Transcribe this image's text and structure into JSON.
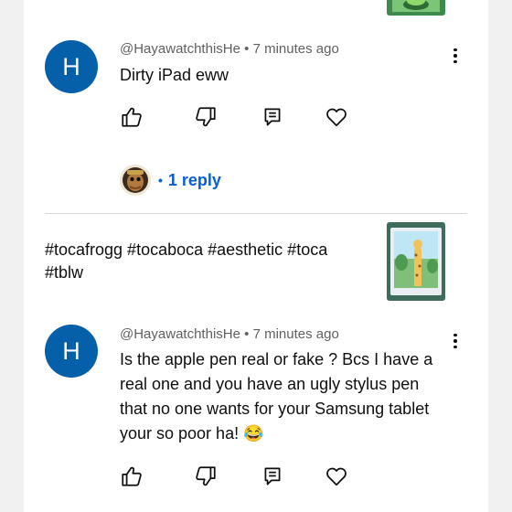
{
  "comments": [
    {
      "avatar_letter": "H",
      "author": "@HayawatchthisHe",
      "time": "7 minutes ago",
      "text": "Dirty iPad eww",
      "replies_label": "1 reply"
    },
    {
      "avatar_letter": "H",
      "author": "@HayawatchthisHe",
      "time": "7 minutes ago",
      "text": "Is the apple pen real or fake ? Bcs I have a real one and you have an ugly stylus pen that no one wants for your Samsung tablet your so poor ha! 😂"
    }
  ],
  "separator": "•",
  "video": {
    "hashtags": "#tocafrogg #tocaboca #aesthetic #toca #tblw"
  },
  "colors": {
    "avatar": "#065fa9",
    "link": "#065fd4",
    "meta": "#606060"
  },
  "icons": [
    "thumb-up-icon",
    "thumb-down-icon",
    "reply-icon",
    "heart-icon",
    "more-vert-icon"
  ]
}
